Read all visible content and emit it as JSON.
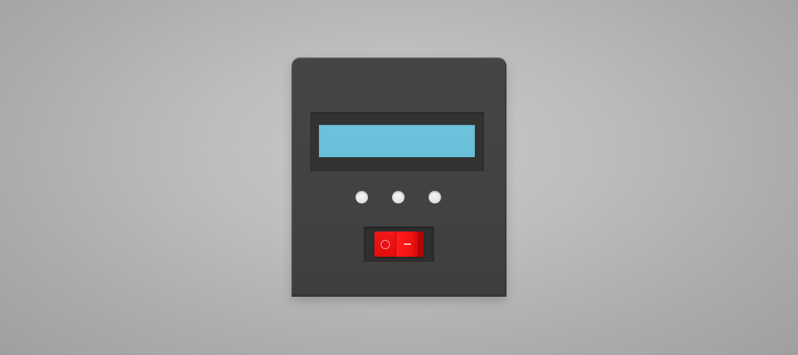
{
  "scene": {
    "description_label": "",
    "background_color": "#b5b5b5"
  },
  "enclosure": {
    "color": "#434343"
  },
  "lcd": {
    "screen_color": "#6bc2da",
    "bezel_color": "#323232",
    "line1": "",
    "line2": ""
  },
  "indicator_holes": {
    "count": 3,
    "color": "#e8e8e8"
  },
  "power_switch": {
    "color": "#ee1111",
    "off_symbol": "circle-icon",
    "on_symbol": "line-icon"
  }
}
